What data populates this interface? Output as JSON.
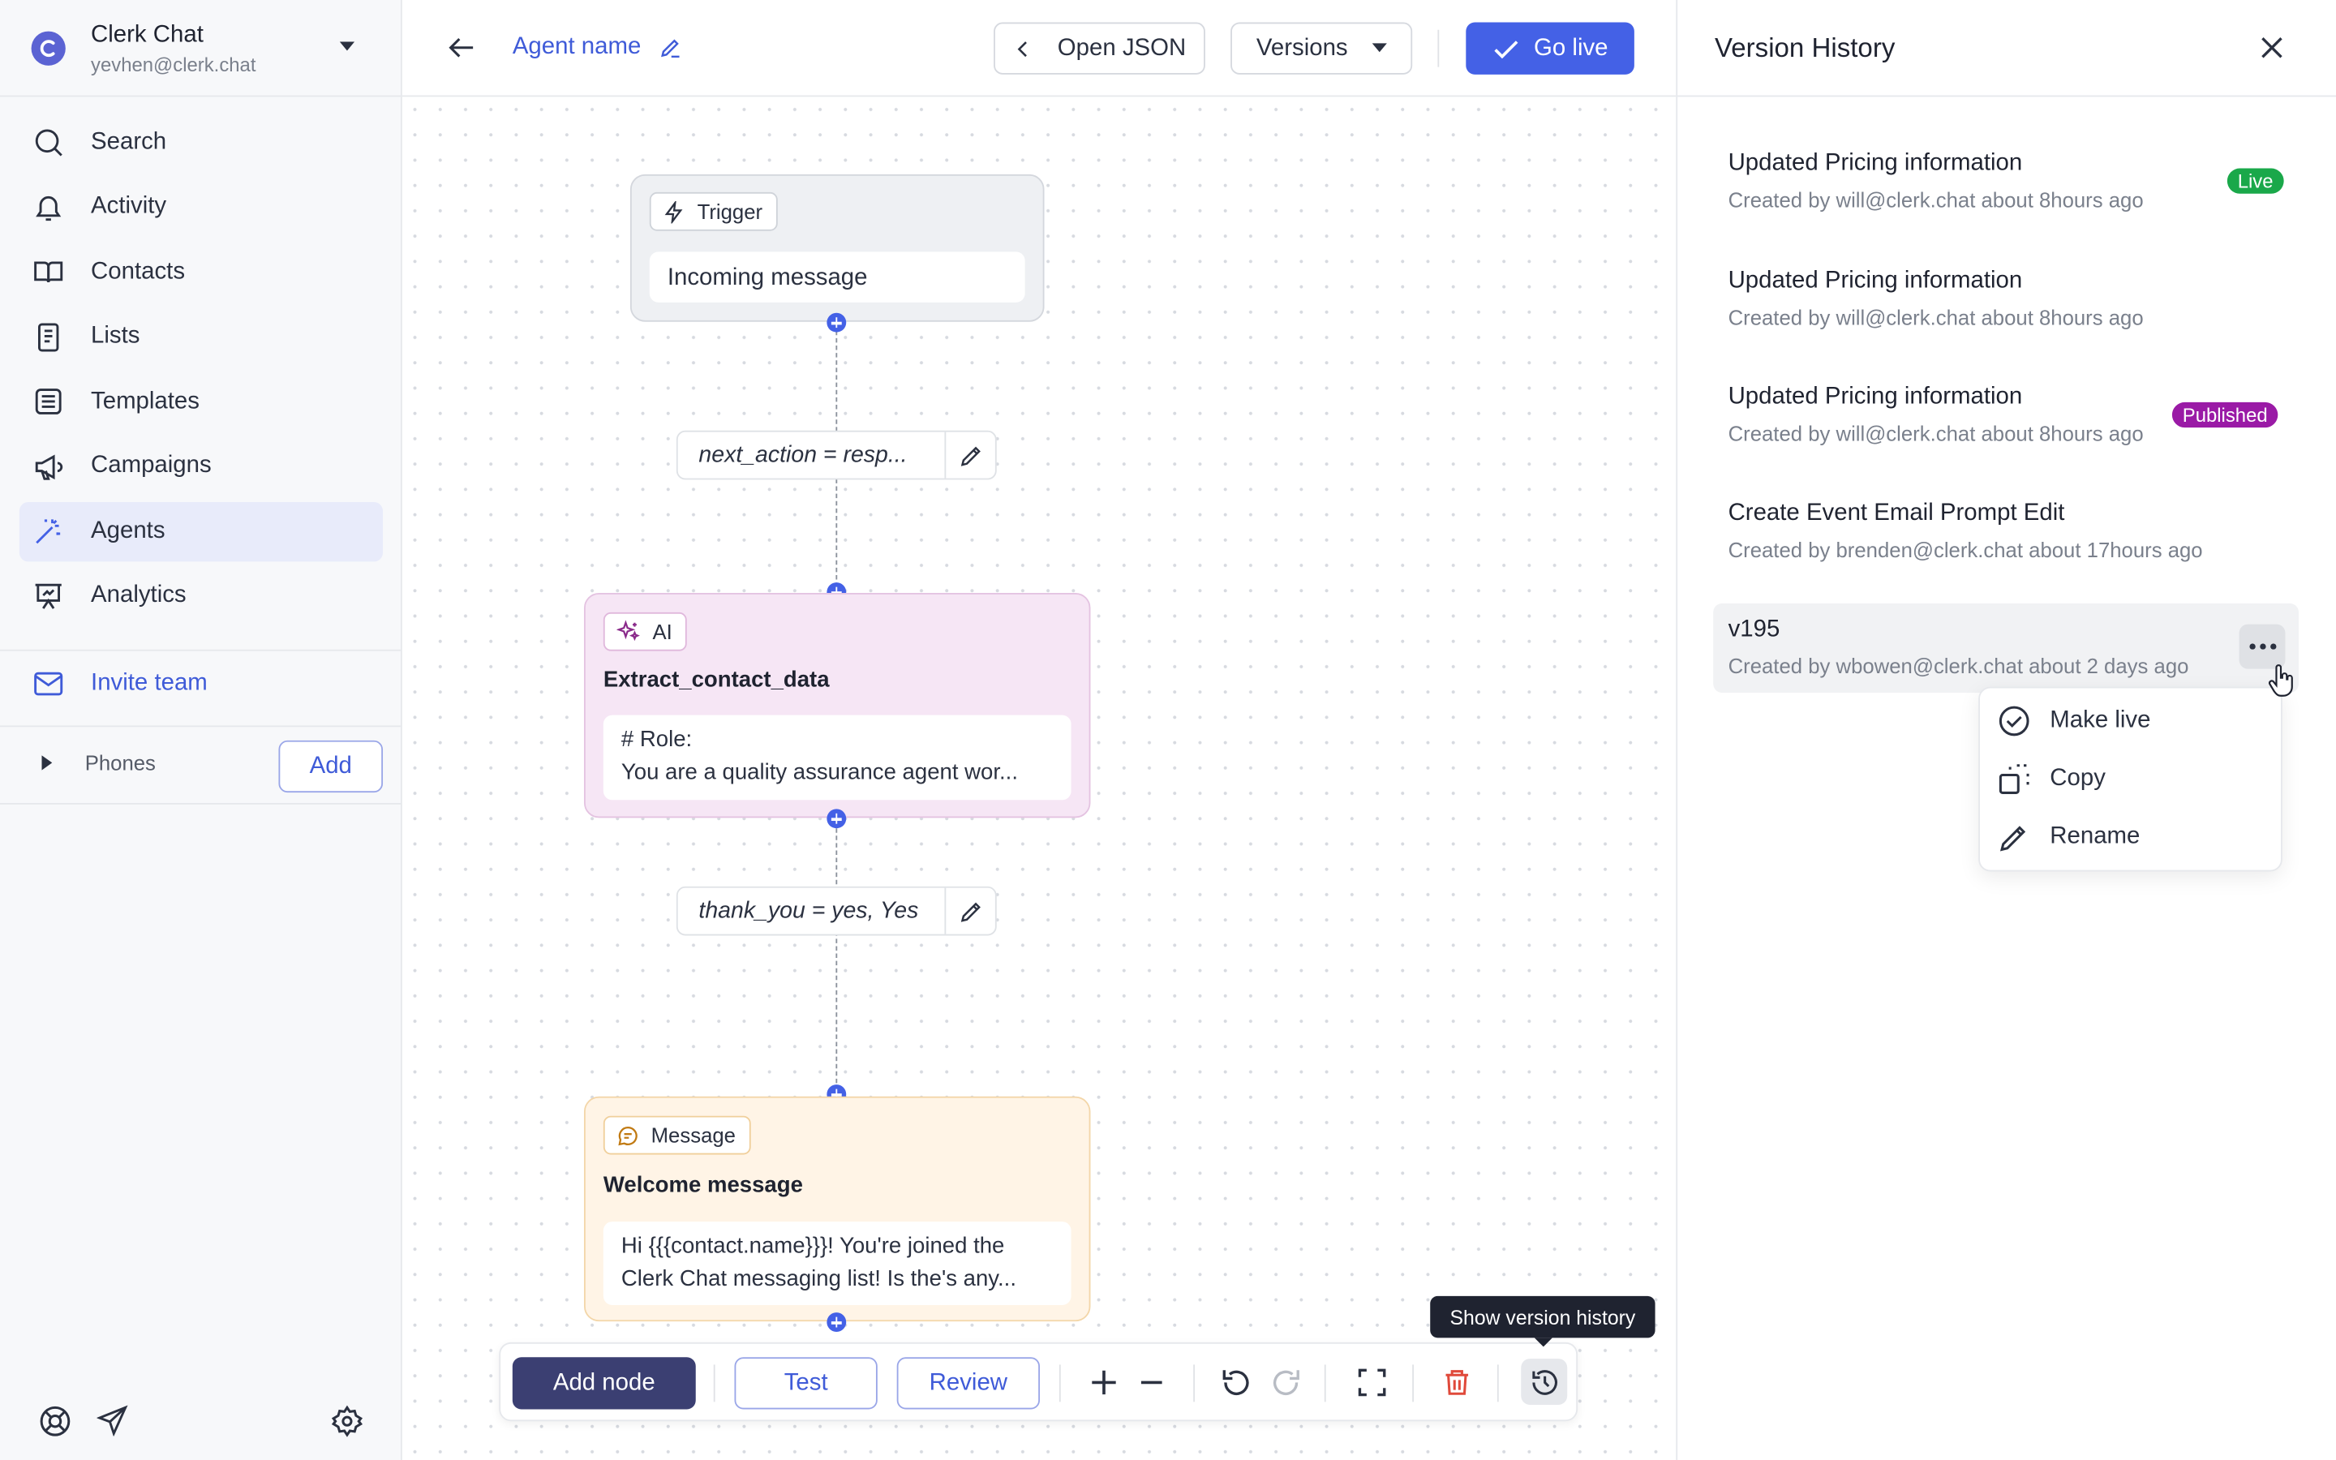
{
  "org": {
    "name": "Clerk Chat",
    "email": "yevhen@clerk.chat"
  },
  "nav": {
    "items": [
      "Search",
      "Activity",
      "Contacts",
      "Lists",
      "Templates",
      "Campaigns",
      "Agents",
      "Analytics"
    ],
    "active": "Agents"
  },
  "invite_label": "Invite team",
  "phones": {
    "label": "Phones",
    "add_label": "Add"
  },
  "header": {
    "agent_name": "Agent name",
    "open_json": "Open JSON",
    "versions": "Versions",
    "go_live": "Go live"
  },
  "flow": {
    "trigger": {
      "badge": "Trigger",
      "value": "Incoming message"
    },
    "condition1": "next_action = resp...",
    "ai": {
      "badge": "AI",
      "title": "Extract_contact_data",
      "line1": "# Role:",
      "line2": "You are a quality assurance agent wor..."
    },
    "condition2": "thank_you = yes, Yes",
    "message": {
      "badge": "Message",
      "title": "Welcome message",
      "line1": "Hi {{{contact.name}}}! You're joined the",
      "line2": "Clerk Chat messaging list! Is the's any..."
    }
  },
  "toolbar": {
    "add_node": "Add node",
    "test": "Test",
    "review": "Review",
    "tooltip": "Show version history"
  },
  "history": {
    "title": "Version History",
    "versions": [
      {
        "name": "Updated Pricing information",
        "meta": "Created by will@clerk.chat about 8hours ago",
        "badge": "Live"
      },
      {
        "name": "Updated Pricing information",
        "meta": "Created by will@clerk.chat about 8hours ago",
        "badge": ""
      },
      {
        "name": "Updated Pricing information",
        "meta": "Created by will@clerk.chat about 8hours ago",
        "badge": "Published"
      },
      {
        "name": "Create Event Email Prompt Edit",
        "meta": "Created by brenden@clerk.chat about 17hours ago",
        "badge": ""
      },
      {
        "name": "v195",
        "meta": "Created by wbowen@clerk.chat about 2 days ago",
        "badge": ""
      }
    ],
    "menu": [
      "Make live",
      "Copy",
      "Rename"
    ]
  },
  "colors": {
    "accent": "#4461e6",
    "live_badge": "#1aa84a",
    "published_badge": "#9a1aa6",
    "ai_node": "#f6e6f5",
    "message_node": "#fff4e6",
    "trigger_node": "#eef0f3",
    "add_node_button": "#3b3f72"
  }
}
